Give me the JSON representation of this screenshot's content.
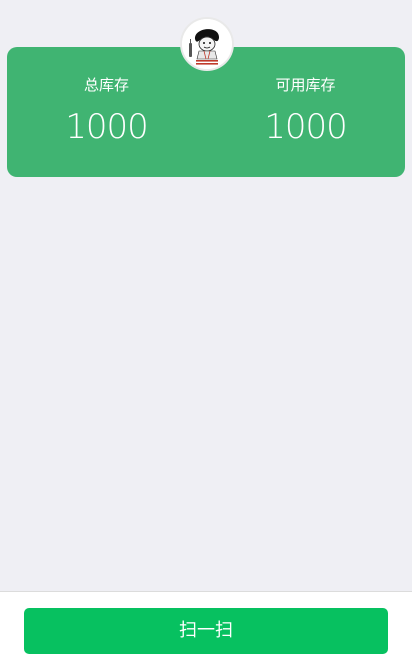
{
  "summary": {
    "total_stock": {
      "label": "总库存",
      "value": "1000"
    },
    "available_stock": {
      "label": "可用库存",
      "value": "1000"
    }
  },
  "avatar": {
    "icon": "meme-cartoon-avatar"
  },
  "footer": {
    "scan_button_label": "扫一扫"
  },
  "colors": {
    "card": "#40B472",
    "button": "#07C160",
    "background": "#EFEFF4"
  }
}
